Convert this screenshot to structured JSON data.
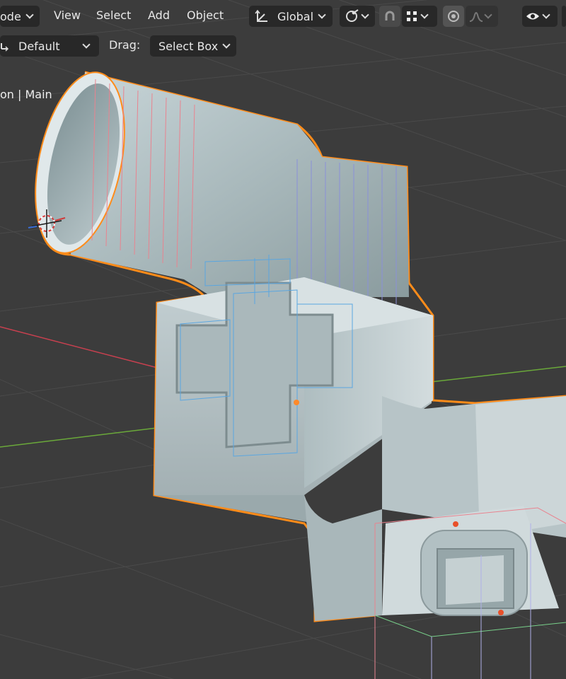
{
  "header": {
    "mode_label": "ode",
    "menu": [
      "View",
      "Select",
      "Add",
      "Object"
    ],
    "transform_orientation": "Global",
    "icons": [
      "transform-gizmo-icon",
      "snap-link-icon",
      "snap-magnet-icon",
      "grid-snap-icon",
      "proportional-edit-icon",
      "falloff-curve-icon",
      "visibility-eye-icon"
    ]
  },
  "toolbar": {
    "orientation_value": "Default",
    "drag_label": "Drag:",
    "drag_value": "Select Box"
  },
  "viewport": {
    "view_name": "on | Main"
  },
  "colors": {
    "selection_outline": "#ff8c1a",
    "background": "#3c3c3c",
    "x_axis": "#d04050",
    "y_axis": "#6aa83a"
  }
}
